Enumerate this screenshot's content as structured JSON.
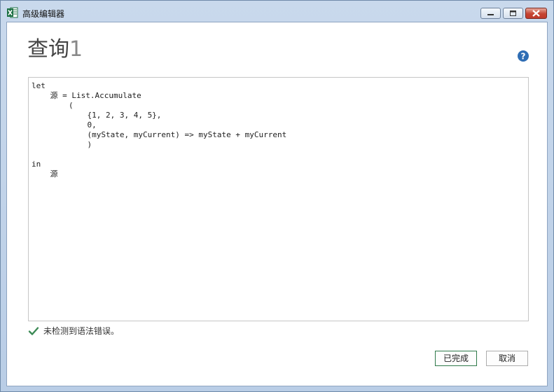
{
  "window": {
    "title": "高级编辑器",
    "app_icon": "excel-icon"
  },
  "header": {
    "title_main": "查询",
    "title_num": "1",
    "help_icon": "help-icon"
  },
  "editor": {
    "code": "let\n    源 = List.Accumulate\n        (\n            {1, 2, 3, 4, 5},\n            0,\n            (myState, myCurrent) => myState + myCurrent\n            )\n\nin\n    源"
  },
  "status": {
    "icon": "check-icon",
    "text": "未检测到语法错误。"
  },
  "buttons": {
    "done_label": "已完成",
    "cancel_label": "取消"
  },
  "colors": {
    "accent_green": "#2f7a4a",
    "help_blue": "#2e6db4"
  }
}
